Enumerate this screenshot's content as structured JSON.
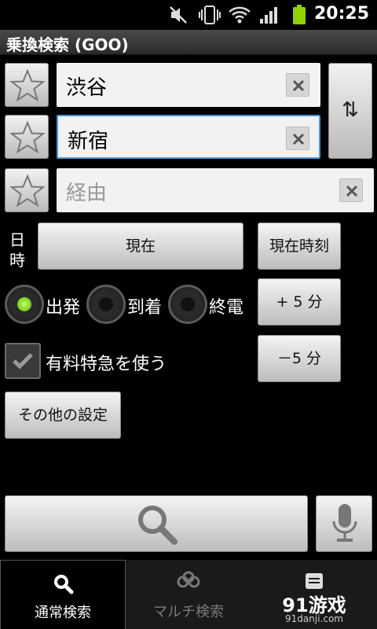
{
  "status_bar": {
    "time": "20:25",
    "icons": [
      "mute-icon",
      "vibrate-icon",
      "wifi-icon",
      "signal-icon",
      "battery-icon"
    ]
  },
  "title": "乗換検索 (GOO)",
  "fields": {
    "from": {
      "value": "渋谷"
    },
    "to": {
      "value": "新宿"
    },
    "via": {
      "placeholder": "経由"
    }
  },
  "swap_label": "⇅",
  "date": {
    "label_top": "日",
    "label_bottom": "時",
    "now_button": "現在",
    "now_time_button": "現在時刻"
  },
  "time_adjust": {
    "plus": "+ 5 分",
    "minus": "－5 分"
  },
  "radios": [
    {
      "label": "出発",
      "selected": true
    },
    {
      "label": "到着",
      "selected": false
    },
    {
      "label": "終電",
      "selected": false
    }
  ],
  "express": {
    "label": "有料特急を使う",
    "checked": true
  },
  "other_settings": "その他の設定",
  "tabs": [
    {
      "label": "通常検索",
      "icon": "search-icon",
      "active": true
    },
    {
      "label": "マルチ検索",
      "icon": "multi-search-icon",
      "active": false
    },
    {
      "label": "91游戏",
      "icon": "list-icon",
      "active": false
    }
  ],
  "watermark": "91danji.com"
}
